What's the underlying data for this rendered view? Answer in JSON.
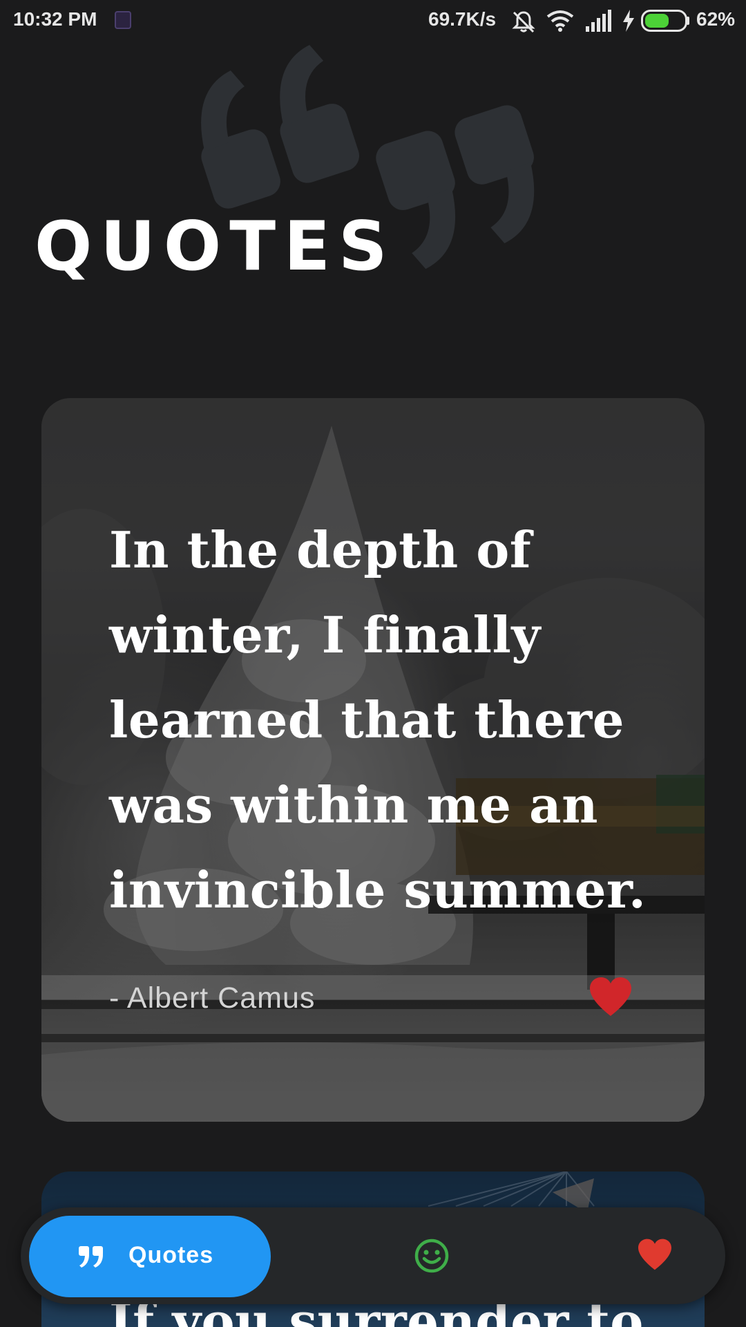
{
  "status_bar": {
    "time": "10:32 PM",
    "network_speed": "69.7K/s",
    "battery_percent": "62%",
    "battery_level": 0.62,
    "icons": [
      "app-notification-icon",
      "silent-icon",
      "wifi-icon",
      "signal-icon",
      "charging-icon",
      "battery-icon"
    ]
  },
  "header": {
    "title": "QUOTES",
    "watermark_icon": "quote-marks-icon"
  },
  "quotes": [
    {
      "text": "In the depth of winter, I finally learned that there was within me an invincible summer.",
      "author": "- Albert Camus",
      "liked": true
    },
    {
      "text": "If you surrender to",
      "author": "",
      "liked": false
    }
  ],
  "bottom_nav": {
    "items": [
      {
        "label": "Quotes",
        "icon": "quote-icon",
        "active": true
      },
      {
        "label": "",
        "icon": "smiley-icon",
        "active": false
      },
      {
        "label": "",
        "icon": "heart-icon",
        "active": false
      }
    ]
  },
  "colors": {
    "background": "#1b1b1c",
    "accent": "#2196f3",
    "like_red": "#e03a2f",
    "smiley_green": "#3fae49",
    "nav_bg": "#252729"
  }
}
